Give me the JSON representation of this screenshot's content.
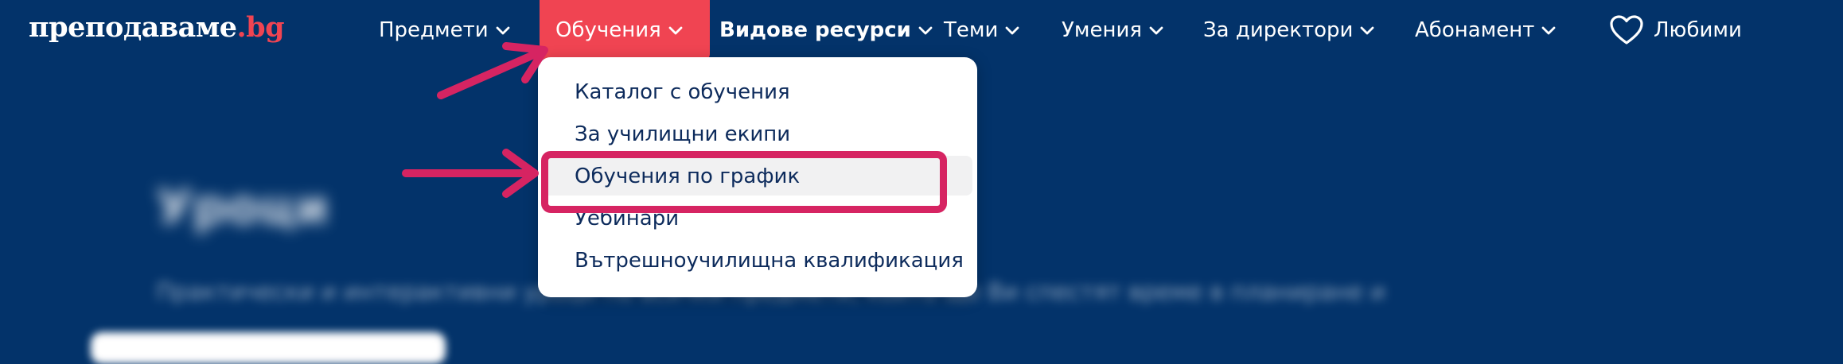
{
  "logo": {
    "main": "преподаваме",
    "dot_tld": ".bg"
  },
  "nav": {
    "items": [
      {
        "label": "Предмети"
      },
      {
        "label": "Обучения"
      },
      {
        "label": "Видове ресурси"
      },
      {
        "label": "Теми"
      },
      {
        "label": "Умения"
      },
      {
        "label": "За директори"
      },
      {
        "label": "Абонамент"
      }
    ],
    "active_item": "Обучения",
    "favorites_label": "Любими"
  },
  "dropdown": {
    "items": [
      {
        "label": "Каталог с обучения"
      },
      {
        "label": "За училищни екипи"
      },
      {
        "label": "Обучения по график"
      },
      {
        "label": "Уебинари"
      },
      {
        "label": "Вътрешноучилищна квалификация"
      }
    ],
    "highlighted_item": "Обучения по график"
  },
  "background_content": {
    "title": "Уроци",
    "description": "Практически и интерактивни уроци по всички предмети, които ще Ви спестят време в планиране и"
  },
  "colors": {
    "nav_background": "#03336a",
    "accent": "#f04452",
    "annotation": "#d62462",
    "dropdown_background": "#ffffff",
    "dropdown_text": "#0d2b5c"
  },
  "icons": {
    "chevron": "chevron-down-icon",
    "heart": "heart-icon",
    "arrow": "arrow-annotation-icon"
  }
}
